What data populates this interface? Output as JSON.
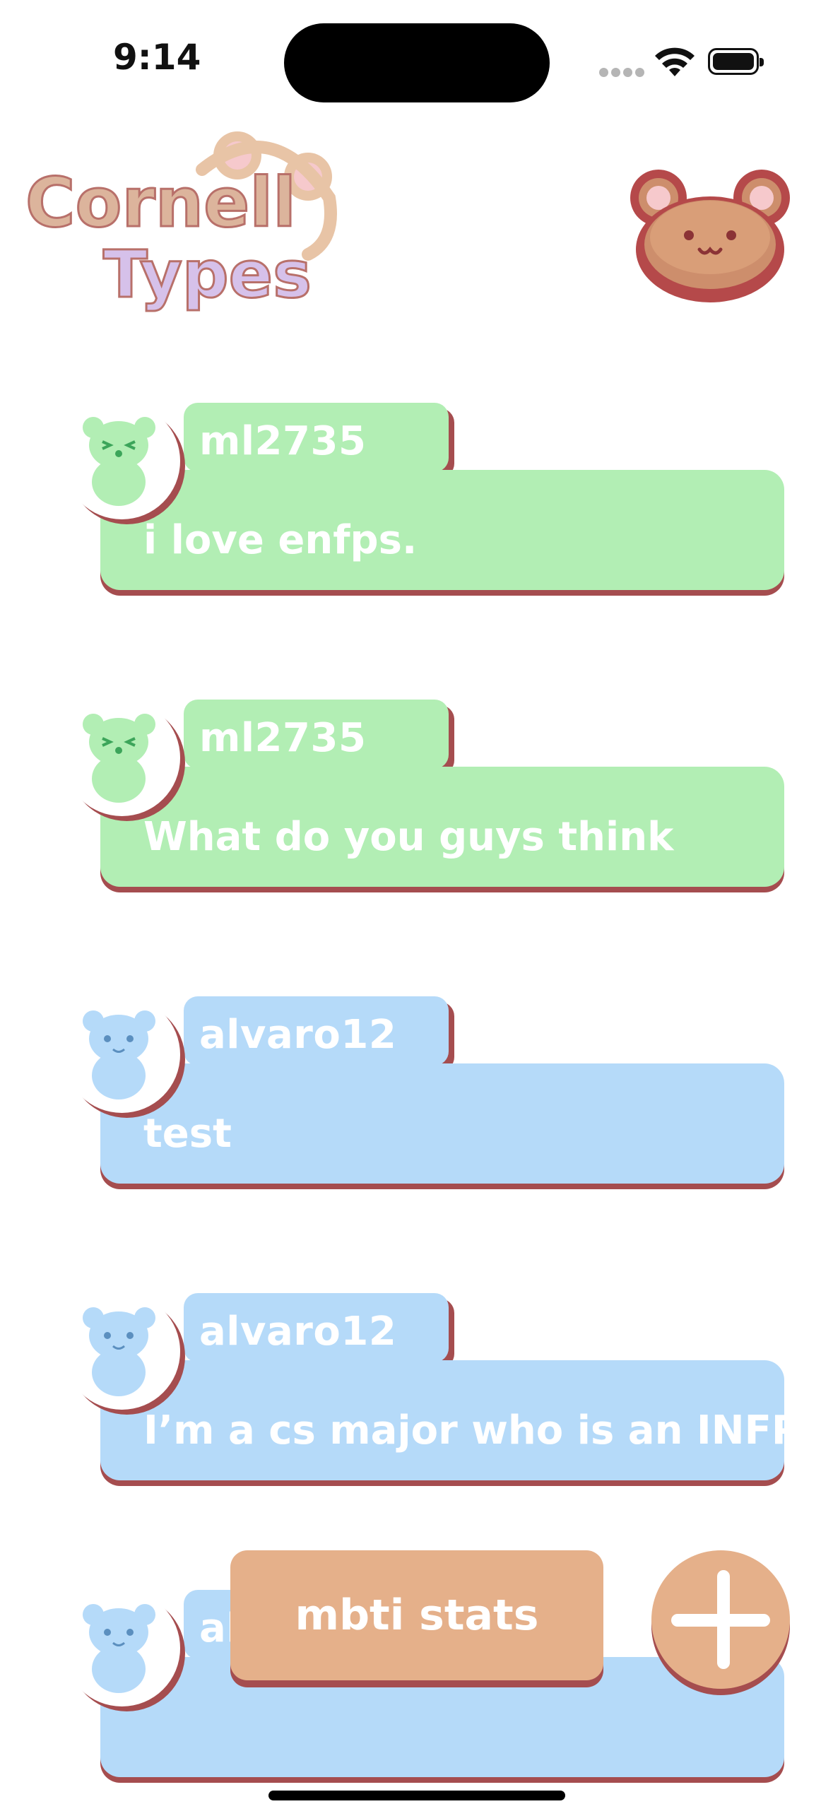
{
  "status_bar": {
    "time": "9:14"
  },
  "header": {
    "logo_line1": "Cornell",
    "logo_line2": "Types",
    "profile_icon": "bear-face-icon"
  },
  "posts": [
    {
      "username": "ml2735",
      "message": "i love enfps.",
      "theme": "green",
      "avatar": "green-bear-avatar-icon"
    },
    {
      "username": "ml2735",
      "message": "What do you guys think",
      "theme": "green",
      "avatar": "green-bear-avatar-icon"
    },
    {
      "username": "alvaro12",
      "message": "test",
      "theme": "blue",
      "avatar": "blue-bear-avatar-icon"
    },
    {
      "username": "alvaro12",
      "message": "I’m a cs major who is an INFP!",
      "theme": "blue",
      "avatar": "blue-bear-avatar-icon"
    },
    {
      "username": "al",
      "message": "",
      "theme": "blue",
      "avatar": "blue-bear-avatar-icon"
    }
  ],
  "actions": {
    "stats_label": "mbti stats",
    "add_icon": "plus-icon"
  },
  "colors": {
    "green": "#b2eeb4",
    "blue": "#b5daf9",
    "accent_shadow": "#a54d4f",
    "button": "#e5b08a"
  }
}
